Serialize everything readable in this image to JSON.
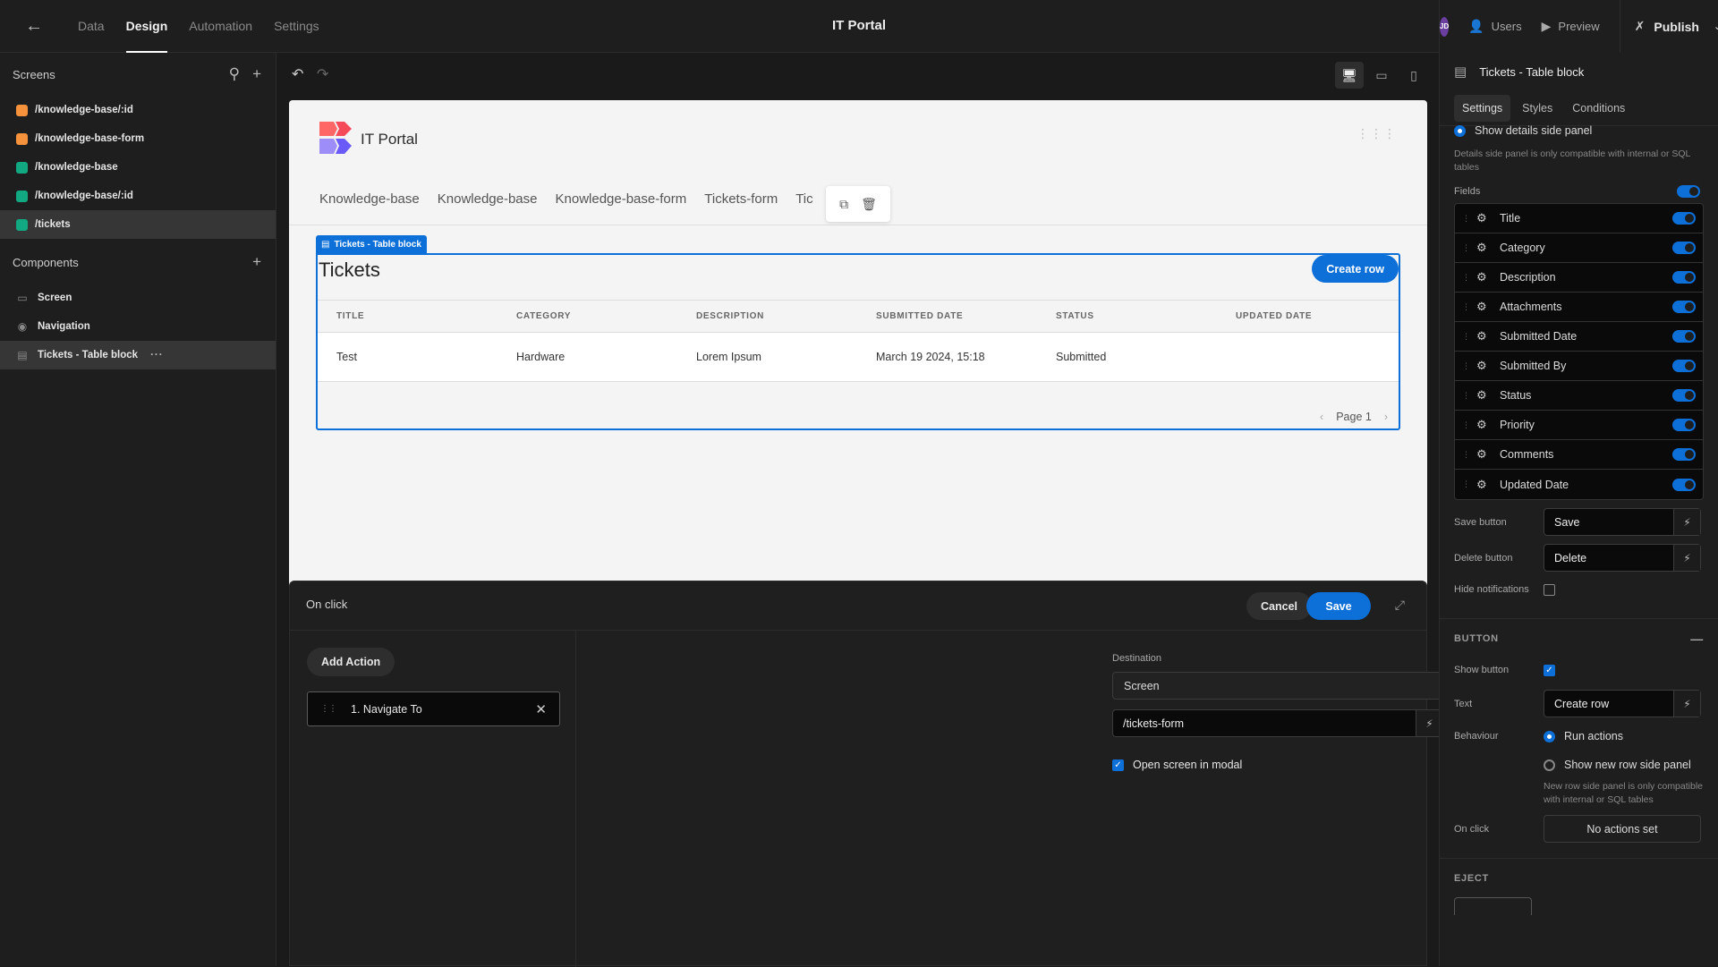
{
  "topbar": {
    "tabs": [
      {
        "label": "Data",
        "active": false
      },
      {
        "label": "Design",
        "active": true
      },
      {
        "label": "Automation",
        "active": false
      },
      {
        "label": "Settings",
        "active": false
      }
    ],
    "title": "IT Portal",
    "avatar_initials": "JD",
    "users_label": "Users",
    "preview_label": "Preview",
    "publish_label": "Publish"
  },
  "left": {
    "screens_title": "Screens",
    "screens": [
      {
        "label": "/knowledge-base/:id",
        "color": "#f7923c"
      },
      {
        "label": "/knowledge-base-form",
        "color": "#f7923c"
      },
      {
        "label": "/knowledge-base",
        "color": "#12a982"
      },
      {
        "label": "/knowledge-base/:id",
        "color": "#12a982"
      },
      {
        "label": "/tickets",
        "color": "#12a982",
        "selected": true
      }
    ],
    "components_title": "Components",
    "components": [
      {
        "label": "Screen",
        "icon": "screen-icon"
      },
      {
        "label": "Navigation",
        "icon": "eye-icon"
      },
      {
        "label": "Tickets - Table block",
        "icon": "table-icon",
        "selected": true
      }
    ]
  },
  "preview": {
    "app_name": "IT Portal",
    "nav_links": [
      "Knowledge-base",
      "Knowledge-base",
      "Knowledge-base-form",
      "Tickets-form",
      "Tic"
    ],
    "table_block_label": "Tickets - Table block",
    "table_title": "Tickets",
    "create_row_label": "Create row",
    "columns": [
      "TITLE",
      "CATEGORY",
      "DESCRIPTION",
      "SUBMITTED DATE",
      "STATUS",
      "UPDATED DATE"
    ],
    "rows": [
      [
        "Test",
        "Hardware",
        "Lorem Ipsum",
        "March 19 2024, 15:18",
        "Submitted",
        ""
      ]
    ],
    "page_label": "Page 1"
  },
  "modal": {
    "title": "On click",
    "cancel_label": "Cancel",
    "save_label": "Save",
    "add_action_label": "Add Action",
    "actions": [
      "1. Navigate To"
    ],
    "destination_label": "Destination",
    "destination_type": "Screen",
    "destination_value": "/tickets-form",
    "open_in_modal_label": "Open screen in modal",
    "open_in_modal": true
  },
  "right": {
    "component_title": "Tickets - Table block",
    "tabs": [
      {
        "label": "Settings",
        "active": true
      },
      {
        "label": "Styles",
        "active": false
      },
      {
        "label": "Conditions",
        "active": false
      }
    ],
    "show_details_label": "Show details side panel",
    "details_hint": "Details side panel is only compatible with internal or SQL tables",
    "fields_label": "Fields",
    "fields": [
      "Title",
      "Category",
      "Description",
      "Attachments",
      "Submitted Date",
      "Submitted By",
      "Status",
      "Priority",
      "Comments",
      "Updated Date"
    ],
    "save_button_label": "Save button",
    "save_button_value": "Save",
    "delete_button_label": "Delete button",
    "delete_button_value": "Delete",
    "hide_notifications_label": "Hide notifications",
    "hide_notifications": false,
    "button_section": "BUTTON",
    "show_button_label": "Show button",
    "show_button": true,
    "text_label": "Text",
    "text_value": "Create row",
    "behaviour_label": "Behaviour",
    "behaviour_options": [
      "Run actions",
      "Show new row side panel"
    ],
    "behaviour_selected": "Run actions",
    "new_row_hint": "New row side panel is only compatible with internal or SQL tables",
    "on_click_label": "On click",
    "on_click_value": "No actions set",
    "eject_section": "EJECT"
  }
}
